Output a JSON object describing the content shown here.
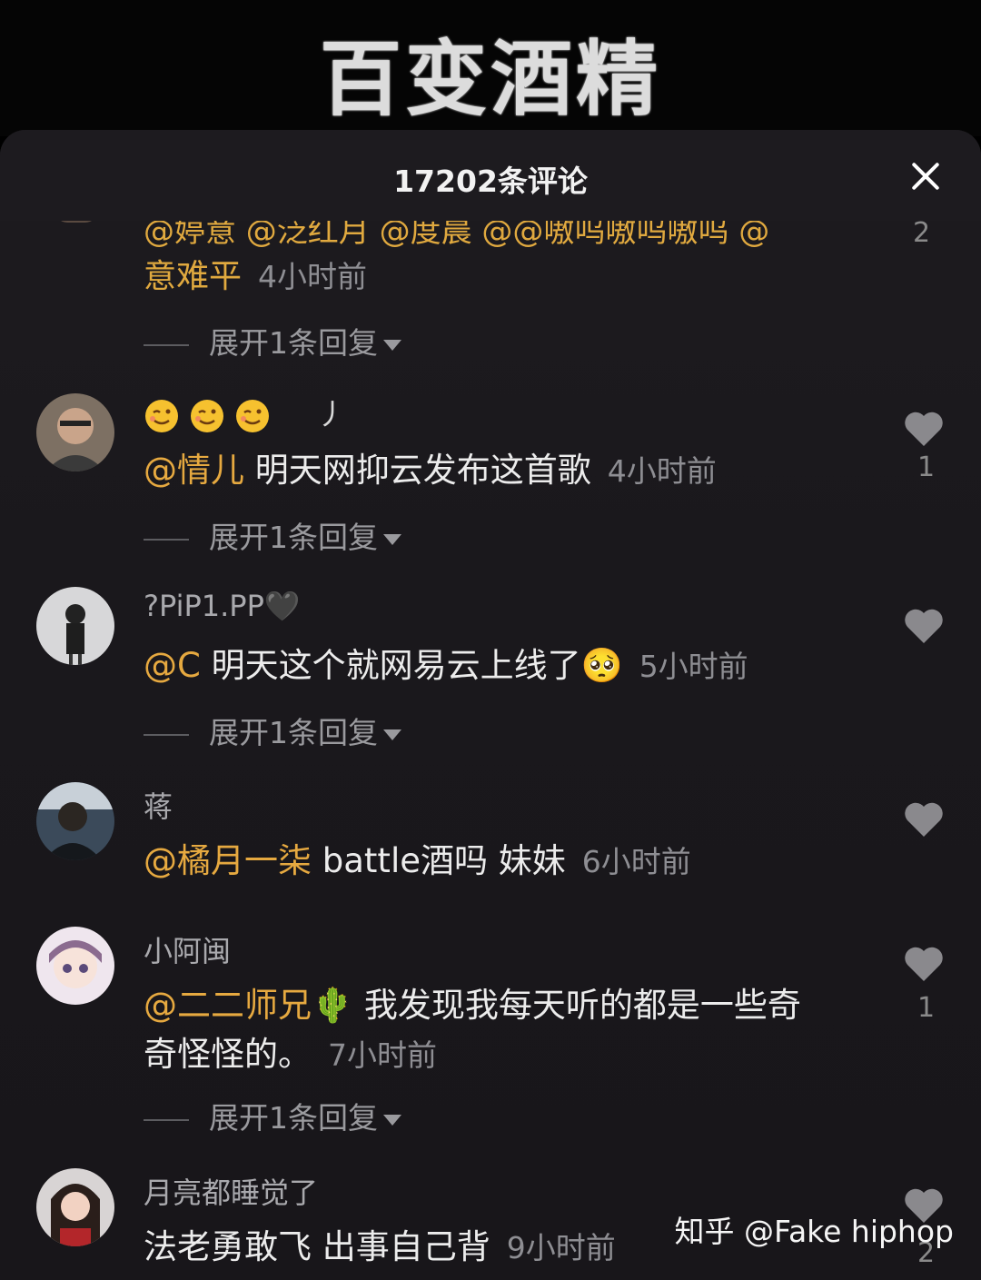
{
  "banner": {
    "title": "百变酒精"
  },
  "sheet": {
    "title": "17202条评论",
    "close_icon": "close-icon"
  },
  "truncated_comment": {
    "mentions_line": "@婷意 @泛红月 @度晨 @@嗷呜嗷呜嗷呜 @",
    "mention_tail": "意难平",
    "time": "4小时前",
    "like_count": "2",
    "expand_label": "展开1条回复"
  },
  "comments": [
    {
      "username": "😉😉😉　丿",
      "mention": "@情儿",
      "text": "明天网抑云发布这首歌",
      "time": "4小时前",
      "like_count": "1",
      "expand_label": "展开1条回复"
    },
    {
      "username": "?PiP1.PP🖤",
      "mention": "@C",
      "text": "明天这个就网易云上线了🥺",
      "time": "5小时前",
      "like_count": "",
      "expand_label": "展开1条回复"
    },
    {
      "username": "蒋",
      "mention": "@橘月一柒",
      "text": "battle酒吗 妹妹",
      "time": "6小时前",
      "like_count": ""
    },
    {
      "username": "小阿闽",
      "mention": "@二二师兄🌵",
      "text": "我发现我每天听的都是一些奇",
      "text_line2": "奇怪怪的。",
      "time": "7小时前",
      "like_count": "1",
      "expand_label": "展开1条回复"
    },
    {
      "username": "月亮都睡觉了",
      "mention": "",
      "text": "法老勇敢飞 出事自己背",
      "time": "9小时前",
      "like_count": "2"
    }
  ],
  "watermark": "知乎 @Fake hiphop",
  "colors": {
    "mention": "#e6a940",
    "background": "#1d1b1f",
    "muted": "#8e8e93"
  }
}
